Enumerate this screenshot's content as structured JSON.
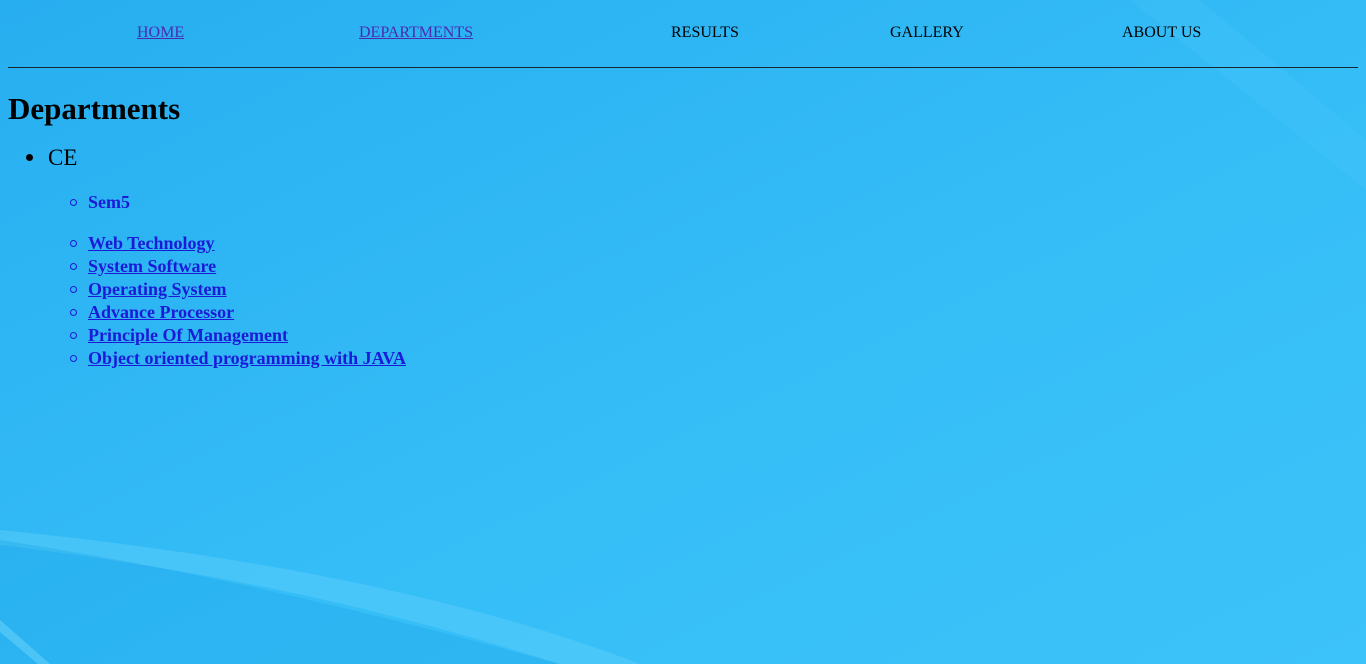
{
  "nav": {
    "home": "HOME",
    "departments": "DEPARTMENTS",
    "results": "RESULTS",
    "gallery": "GALLERY",
    "about": "ABOUT US"
  },
  "page": {
    "title": "Departments"
  },
  "department": {
    "name": "CE",
    "semester": "Sem5",
    "courses": [
      "Web Technology",
      "System Software",
      "Operating System",
      "Advance Processor",
      "Principle Of Management",
      "Object oriented programming with JAVA"
    ]
  },
  "colors": {
    "background": "#2fb4f2",
    "link": "#1a1ad8",
    "visited_link": "#4a2bb0"
  }
}
